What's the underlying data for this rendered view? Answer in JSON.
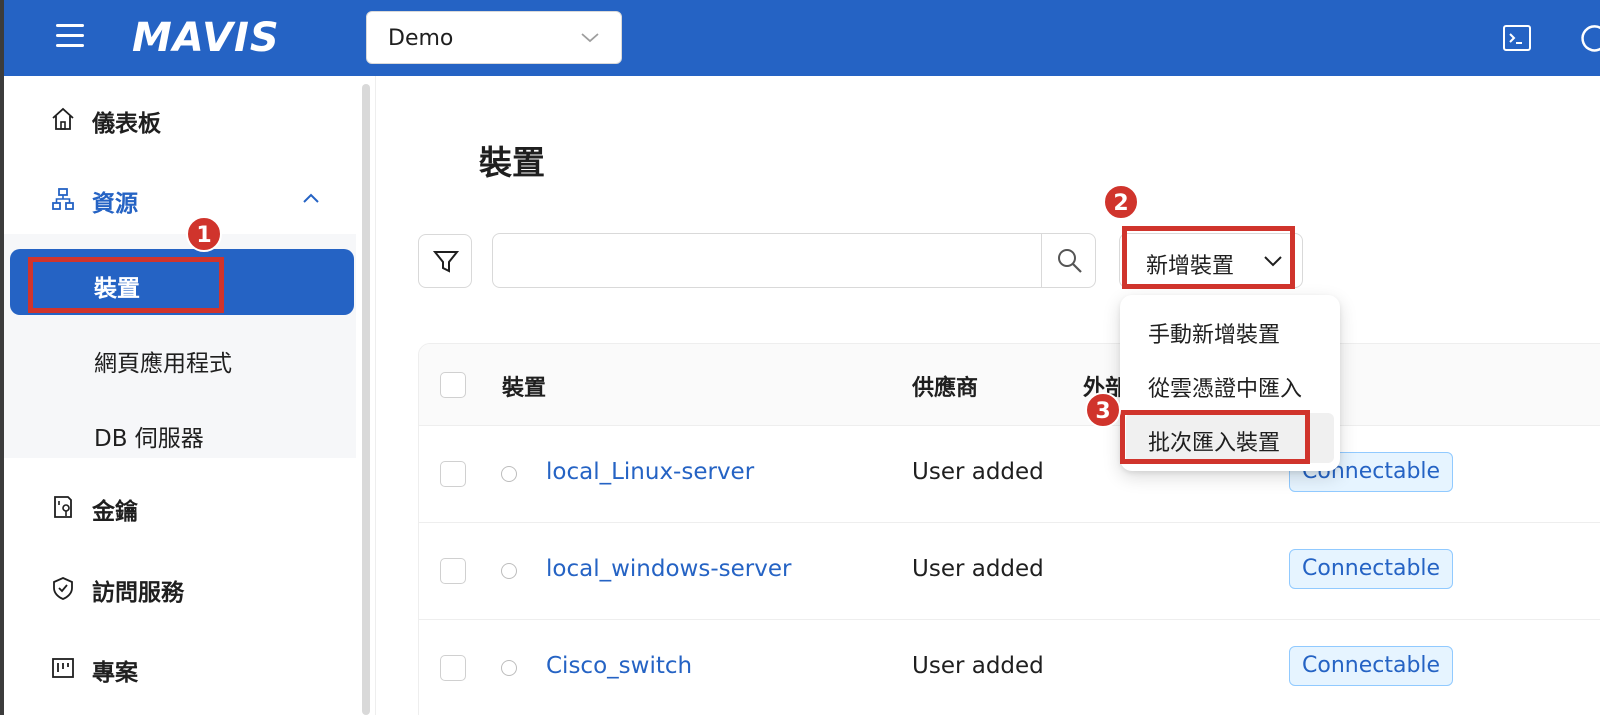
{
  "header": {
    "logo_text": "MAVIS",
    "project_select_value": "Demo"
  },
  "sidebar": {
    "items": [
      {
        "label": "儀表板",
        "icon": "home-icon"
      },
      {
        "label": "資源",
        "icon": "sitemap-icon"
      },
      {
        "label": "金鑰",
        "icon": "key-icon"
      },
      {
        "label": "訪問服務",
        "icon": "shield-check-icon"
      },
      {
        "label": "專案",
        "icon": "project-board-icon"
      }
    ],
    "resource_sub_items": [
      {
        "label": "裝置",
        "selected": true
      },
      {
        "label": "網頁應用程式"
      },
      {
        "label": "DB 伺服器"
      }
    ]
  },
  "main": {
    "title": "裝置",
    "search_placeholder": "",
    "add_button_label": "新增裝置",
    "dropdown_items": [
      "手動新增裝置",
      "從雲憑證中匯入",
      "批次匯入裝置"
    ],
    "table": {
      "headers": [
        "裝置",
        "供應商",
        "外部"
      ],
      "rows": [
        {
          "name": "local_Linux-server",
          "vendor": "User added",
          "status": "Connectable"
        },
        {
          "name": "local_windows-server",
          "vendor": "User added",
          "status": "Connectable"
        },
        {
          "name": "Cisco_switch",
          "vendor": "User added",
          "status": "Connectable"
        }
      ]
    }
  },
  "annotations": {
    "markers": [
      "1",
      "2",
      "3"
    ],
    "highlight_color": "#d0342c"
  },
  "colors": {
    "primary": "#2563c4",
    "badge_bg": "#e6f4ff",
    "badge_border": "#91caff"
  }
}
